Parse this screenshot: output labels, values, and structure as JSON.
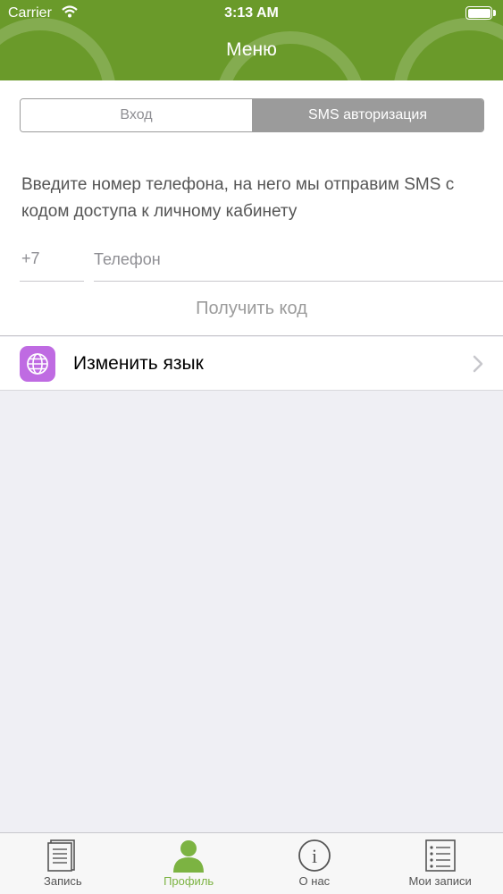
{
  "status_bar": {
    "carrier": "Carrier",
    "time": "3:13 AM"
  },
  "header": {
    "title": "Меню"
  },
  "segmented": {
    "tabs": [
      {
        "label": "Вход",
        "active": false
      },
      {
        "label": "SMS авторизация",
        "active": true
      }
    ]
  },
  "sms_form": {
    "instruction": "Введите номер телефона, на него мы отправим SMS с кодом доступа к личному кабинету",
    "prefix": "+7",
    "phone_placeholder": "Телефон",
    "phone_value": "",
    "get_code_label": "Получить код"
  },
  "menu": {
    "change_language_label": "Изменить язык",
    "change_language_icon": "globe-icon"
  },
  "tab_bar": {
    "items": [
      {
        "label": "Запись",
        "icon": "document-icon",
        "active": false
      },
      {
        "label": "Профиль",
        "icon": "person-icon",
        "active": true
      },
      {
        "label": "О нас",
        "icon": "info-icon",
        "active": false
      },
      {
        "label": "Мои записи",
        "icon": "list-icon",
        "active": false
      }
    ]
  },
  "colors": {
    "header_green": "#6a9a2a",
    "active_tab": "#7cb342",
    "segment_active": "#9b9b9b",
    "language_icon_bg": "#bf6be2"
  }
}
